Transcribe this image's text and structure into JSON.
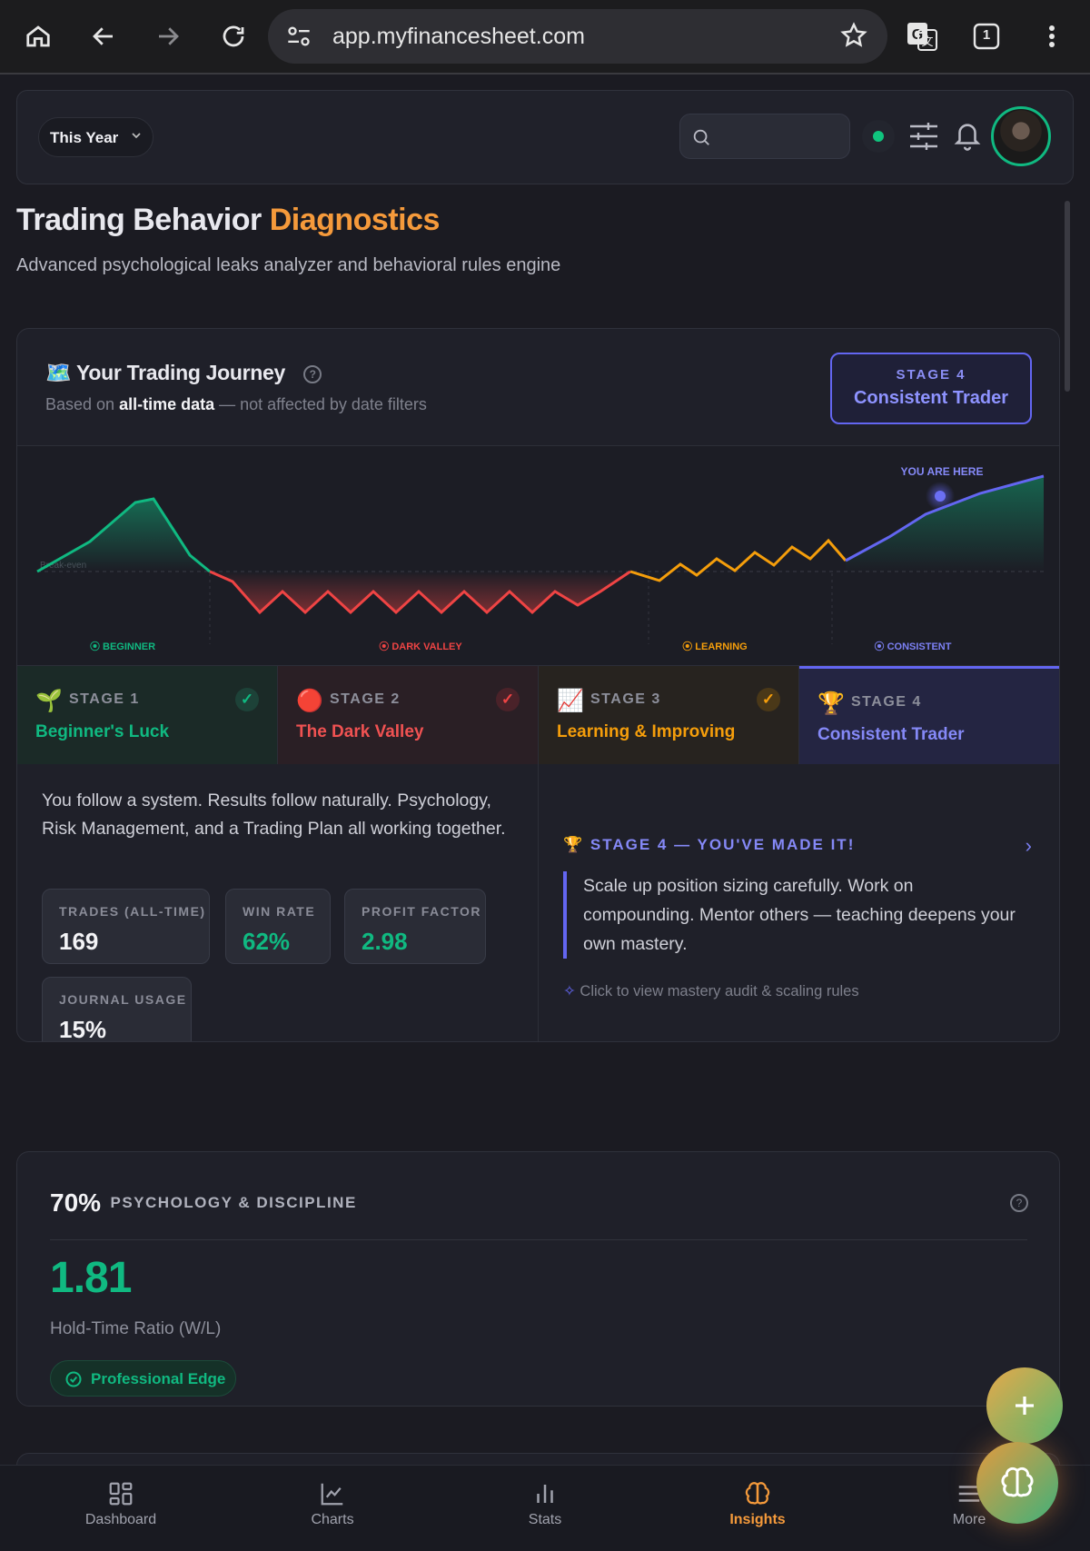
{
  "browser": {
    "url": "app.myfinancesheet.com",
    "tab_count": "1"
  },
  "topbar": {
    "period_select": "This Year",
    "search_placeholder": ""
  },
  "page": {
    "title_main": "Trading Behavior",
    "title_accent": "Diagnostics",
    "subtitle": "Advanced psychological leaks analyzer and behavioral rules engine"
  },
  "journey": {
    "title": "Your Trading Journey",
    "title_emoji": "🗺️",
    "based_on_prefix": "Based on",
    "based_on_bold": "all-time data",
    "based_on_suffix": "— not affected by date filters",
    "current_stage_label": "STAGE 4",
    "current_stage_name": "Consistent Trader",
    "chart": {
      "breakeven_label": "Break-even",
      "you_are_here": "YOU ARE HERE",
      "phase_labels": [
        "BEGINNER",
        "DARK VALLEY",
        "LEARNING",
        "CONSISTENT"
      ],
      "colors": {
        "beginner": "#10b981",
        "dark_valley": "#ef4444",
        "learning": "#f59e0b",
        "consistent": "#6366f1"
      }
    },
    "stages": [
      {
        "emoji": "🌱",
        "label": "STAGE 1",
        "name": "Beginner's Luck",
        "check": "✓"
      },
      {
        "emoji": "🔴",
        "label": "STAGE 2",
        "name": "The Dark Valley",
        "check": "✓"
      },
      {
        "emoji": "📈",
        "label": "STAGE 3",
        "name": "Learning & Improving",
        "check": "✓"
      },
      {
        "emoji": "🏆",
        "label": "STAGE 4",
        "name": "Consistent Trader",
        "check": ""
      }
    ],
    "description": "You follow a system. Results follow naturally. Psychology, Risk Management, and a Trading Plan all working together.",
    "stats": [
      {
        "label": "TRADES (ALL-TIME)",
        "value": "169"
      },
      {
        "label": "WIN RATE",
        "value": "62%"
      },
      {
        "label": "PROFIT FACTOR",
        "value": "2.98"
      },
      {
        "label": "JOURNAL USAGE",
        "value": "15%"
      }
    ],
    "made_it_emoji": "🏆",
    "made_it": "STAGE 4 — YOU'VE MADE IT!",
    "advice": "Scale up position sizing carefully. Work on compounding. Mentor others — teaching deepens your own mastery.",
    "click_hint": "Click to view mastery audit & scaling rules"
  },
  "psychology": {
    "percent": "70%",
    "title": "PSYCHOLOGY & DISCIPLINE",
    "ratio_value": "1.81",
    "ratio_label": "Hold-Time Ratio (W/L)",
    "badge": "Professional Edge"
  },
  "nav": {
    "items": [
      {
        "label": "Dashboard"
      },
      {
        "label": "Charts"
      },
      {
        "label": "Stats"
      },
      {
        "label": "Insights"
      },
      {
        "label": "More"
      }
    ],
    "active": "Insights",
    "active_color": "#f59a3b"
  }
}
